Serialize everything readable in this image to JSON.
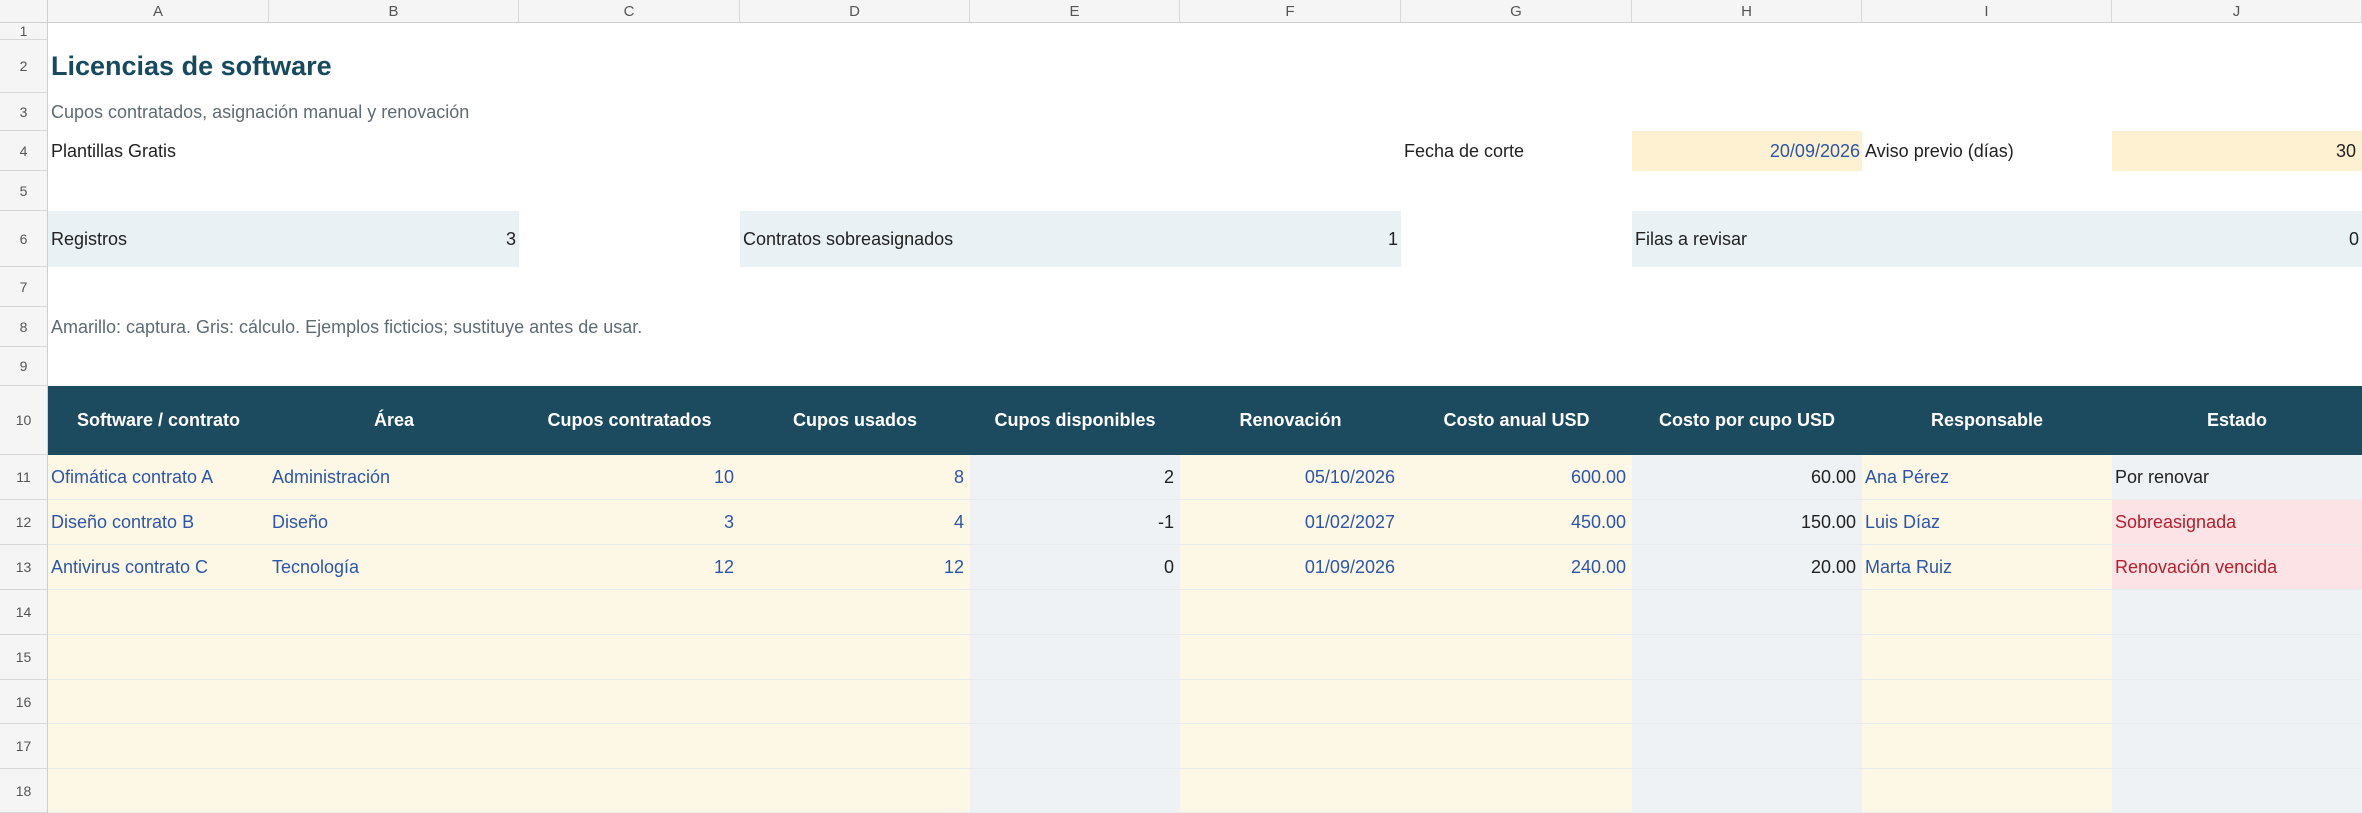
{
  "columns": [
    "A",
    "B",
    "C",
    "D",
    "E",
    "F",
    "G",
    "H",
    "I",
    "J"
  ],
  "rows": [
    "1",
    "2",
    "3",
    "4",
    "5",
    "6",
    "7",
    "8",
    "9",
    "10",
    "11",
    "12",
    "13",
    "14",
    "15",
    "16",
    "17",
    "18"
  ],
  "title": "Licencias de software",
  "subtitle": "Cupos contratados, asignación manual y renovación",
  "company": "Plantillas Gratis",
  "cutoff_label": "Fecha de corte",
  "cutoff_value": "20/09/2026",
  "notice_label": "Aviso previo (días)",
  "notice_value": "30",
  "metrics": [
    {
      "label": "Registros",
      "value": "3"
    },
    {
      "label": "Contratos sobreasignados",
      "value": "1"
    },
    {
      "label": "Filas a revisar",
      "value": "0"
    }
  ],
  "note": "Amarillo: captura. Gris: cálculo. Ejemplos ficticios; sustituye antes de usar.",
  "table": {
    "headers": [
      "Software / contrato",
      "Área",
      "Cupos contratados",
      "Cupos usados",
      "Cupos disponibles",
      "Renovación",
      "Costo anual USD",
      "Costo por cupo USD",
      "Responsable",
      "Estado"
    ],
    "rows": [
      [
        "Ofimática contrato A",
        "Administración",
        "10",
        "8",
        "2",
        "05/10/2026",
        "600.00",
        "60.00",
        "Ana Pérez",
        "Por renovar"
      ],
      [
        "Diseño contrato B",
        "Diseño",
        "3",
        "4",
        "-1",
        "01/02/2027",
        "450.00",
        "150.00",
        "Luis Díaz",
        "Sobreasignada"
      ],
      [
        "Antivirus contrato C",
        "Tecnología",
        "12",
        "12",
        "0",
        "01/09/2026",
        "240.00",
        "20.00",
        "Marta Ruiz",
        "Renovación vencida"
      ]
    ]
  },
  "colors": {
    "header_bg": "#1c4a5e",
    "input_bg": "#fdf1d1",
    "metric_bg": "#eaf1f4",
    "alert_bg": "#fbe3e6",
    "alert_text": "#b3202d",
    "input_text": "#2d56a8"
  }
}
